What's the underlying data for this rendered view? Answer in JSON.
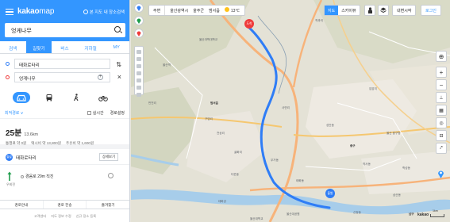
{
  "app": {
    "logo_main": "kakao",
    "logo_sub": "map",
    "toggle_label": "본 지도 내 장소검색"
  },
  "search": {
    "value": "엉게나무"
  },
  "tabs": [
    {
      "label": "검색"
    },
    {
      "label": "길찾기"
    },
    {
      "label": "버스"
    },
    {
      "label": "지하철"
    },
    {
      "label": "MY"
    }
  ],
  "active_tab": 1,
  "route": {
    "origin": "태화로타리",
    "destination": "엉게나무"
  },
  "modes": [
    {
      "name": "car",
      "active": true
    },
    {
      "name": "transit",
      "active": false
    },
    {
      "name": "walk",
      "active": false
    },
    {
      "name": "bike",
      "active": false
    }
  ],
  "options": {
    "sort": "최적경로 ∨",
    "traffic": "실시간",
    "prefs": "경로설정"
  },
  "summary": {
    "time": "25분",
    "distance": "13.6km",
    "toll": "통행료 약 0원",
    "taxi": "택시비 약 13,800원",
    "fuel": "주유비 약 1,600원"
  },
  "step_start": {
    "badge": "출발",
    "name": "태화로타리",
    "btn": "상세보기"
  },
  "step1": {
    "label": "우회전",
    "text": "경음로 29m 직진"
  },
  "bottom": {
    "b1": "경로안내",
    "b2": "경로 전송",
    "b3": "즐겨찾기"
  },
  "footer": {
    "f1": "고객센터",
    "f2": "지도 정보 수정",
    "f3": "신규 장소 등록"
  },
  "map": {
    "home": "주변",
    "addr1": "울산광역시",
    "addr2": "울주군",
    "addr3": "범서읍",
    "weather": "13℃",
    "type_map": "지도",
    "type_sky": "스카이뷰",
    "mymap": "내변시작",
    "login": "로그인",
    "label_start": "출발",
    "label_end": "도착",
    "scale": "1km",
    "wm": "kakao",
    "places": [
      "울산과학대학교",
      "범서읍",
      "구영리",
      "천상리",
      "굴화리",
      "무거동",
      "다운동",
      "태화동",
      "울산역",
      "반천리",
      "사연리",
      "중구",
      "울산 중구청",
      "성안동",
      "약사동",
      "학성동",
      "울산대공원",
      "신정동",
      "삼산동",
      "남구",
      "태화강",
      "울산대학교",
      "척과리",
      "입암리"
    ]
  },
  "colors": {
    "brand": "#3396ff",
    "route": "#2f7df6",
    "start": "#2f7df6",
    "end": "#ef3b3b"
  }
}
